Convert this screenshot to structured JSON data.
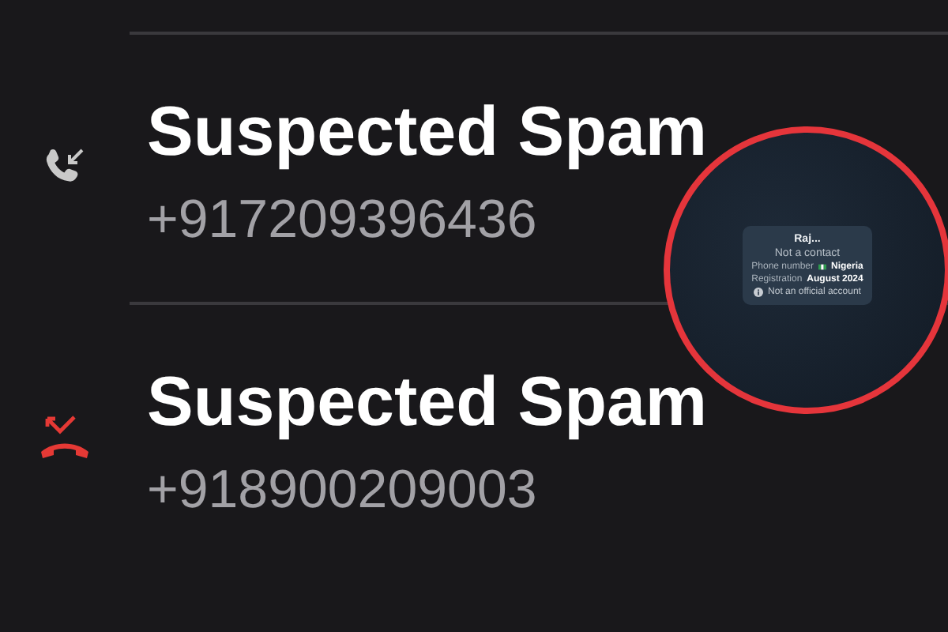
{
  "calls": [
    {
      "kind": "incoming",
      "title": "Suspected Spam",
      "number": "+917209396436"
    },
    {
      "kind": "missed",
      "title": "Suspected Spam",
      "number": "+918900209003"
    }
  ],
  "contact_popup": {
    "name": "Raj...",
    "status": "Not a contact",
    "details": [
      {
        "kind": "country",
        "label": "Phone number",
        "value": "Nigeria"
      },
      {
        "kind": "plain",
        "label": "Registration",
        "value": "August 2024"
      }
    ],
    "note": "Not an official account"
  }
}
